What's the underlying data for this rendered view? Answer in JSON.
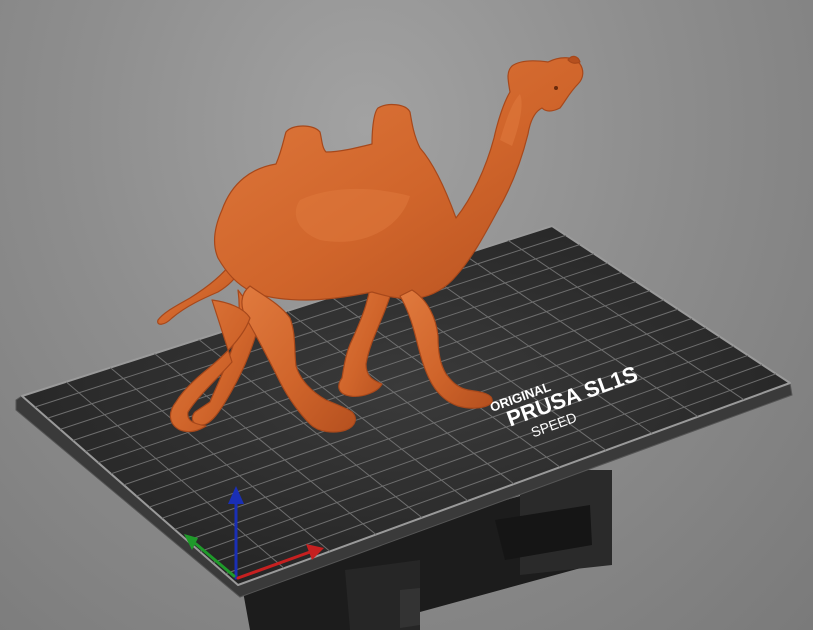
{
  "viewport": {
    "background_color": "#8e8e8e",
    "bed": {
      "brand_line1": "ORIGINAL",
      "brand_line2": "PRUSA SL1S",
      "brand_line3": "SPEED",
      "plate_color": "#2b2b2b",
      "grid_color": "#6e6e6e",
      "edge_color": "#9a9a9a"
    },
    "model": {
      "name": "camel",
      "color": "#d0652b",
      "shade_color": "#b5501f",
      "highlight_color": "#e07a3e"
    },
    "axes": {
      "x_color": "#c62020",
      "y_color": "#1f9a2a",
      "z_color": "#1a2fb5"
    }
  }
}
